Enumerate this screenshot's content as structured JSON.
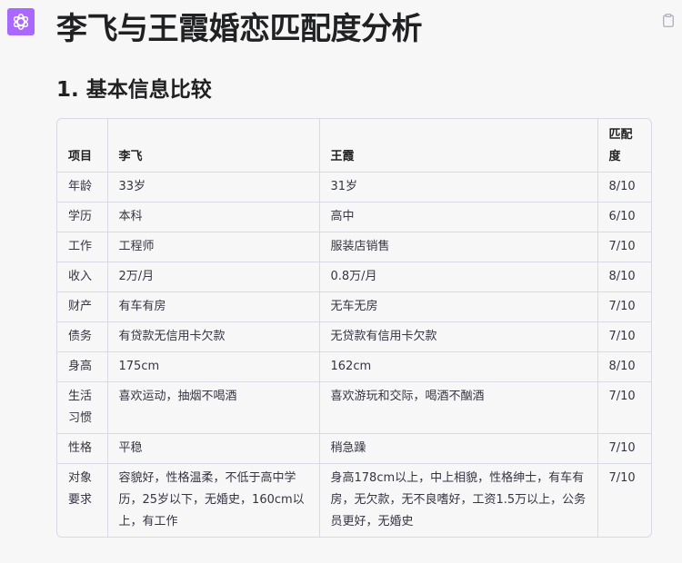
{
  "title": "李飞与王霞婚恋匹配度分析",
  "section_heading": "1. 基本信息比较",
  "table": {
    "headers": [
      "项目",
      "李飞",
      "王霞",
      "匹配度"
    ],
    "rows": [
      [
        "年龄",
        "33岁",
        "31岁",
        "8/10"
      ],
      [
        "学历",
        "本科",
        "高中",
        "6/10"
      ],
      [
        "工作",
        "工程师",
        "服装店销售",
        "7/10"
      ],
      [
        "收入",
        "2万/月",
        "0.8万/月",
        "8/10"
      ],
      [
        "财产",
        "有车有房",
        "无车无房",
        "7/10"
      ],
      [
        "债务",
        "有贷款无信用卡欠款",
        "无贷款有信用卡欠款",
        "7/10"
      ],
      [
        "身高",
        "175cm",
        "162cm",
        "8/10"
      ],
      [
        "生活习惯",
        "喜欢运动，抽烟不喝酒",
        "喜欢游玩和交际，喝酒不酗酒",
        "7/10"
      ],
      [
        "性格",
        "平稳",
        "稍急躁",
        "7/10"
      ],
      [
        "对象要求",
        "容貌好，性格温柔，不低于高中学历，25岁以下，无婚史，160cm以上，有工作",
        "身高178cm以上，中上相貌，性格绅士，有车有房，无欠款，无不良嗜好，工资1.5万以上，公务员更好，无婚史",
        "7/10"
      ]
    ]
  },
  "icons": {
    "avatar": "openai-logo-icon",
    "copy": "clipboard-icon"
  },
  "colors": {
    "avatar_bg": "#ab68ff",
    "page_bg": "#f7f7f8",
    "border": "#d9d9e3"
  }
}
